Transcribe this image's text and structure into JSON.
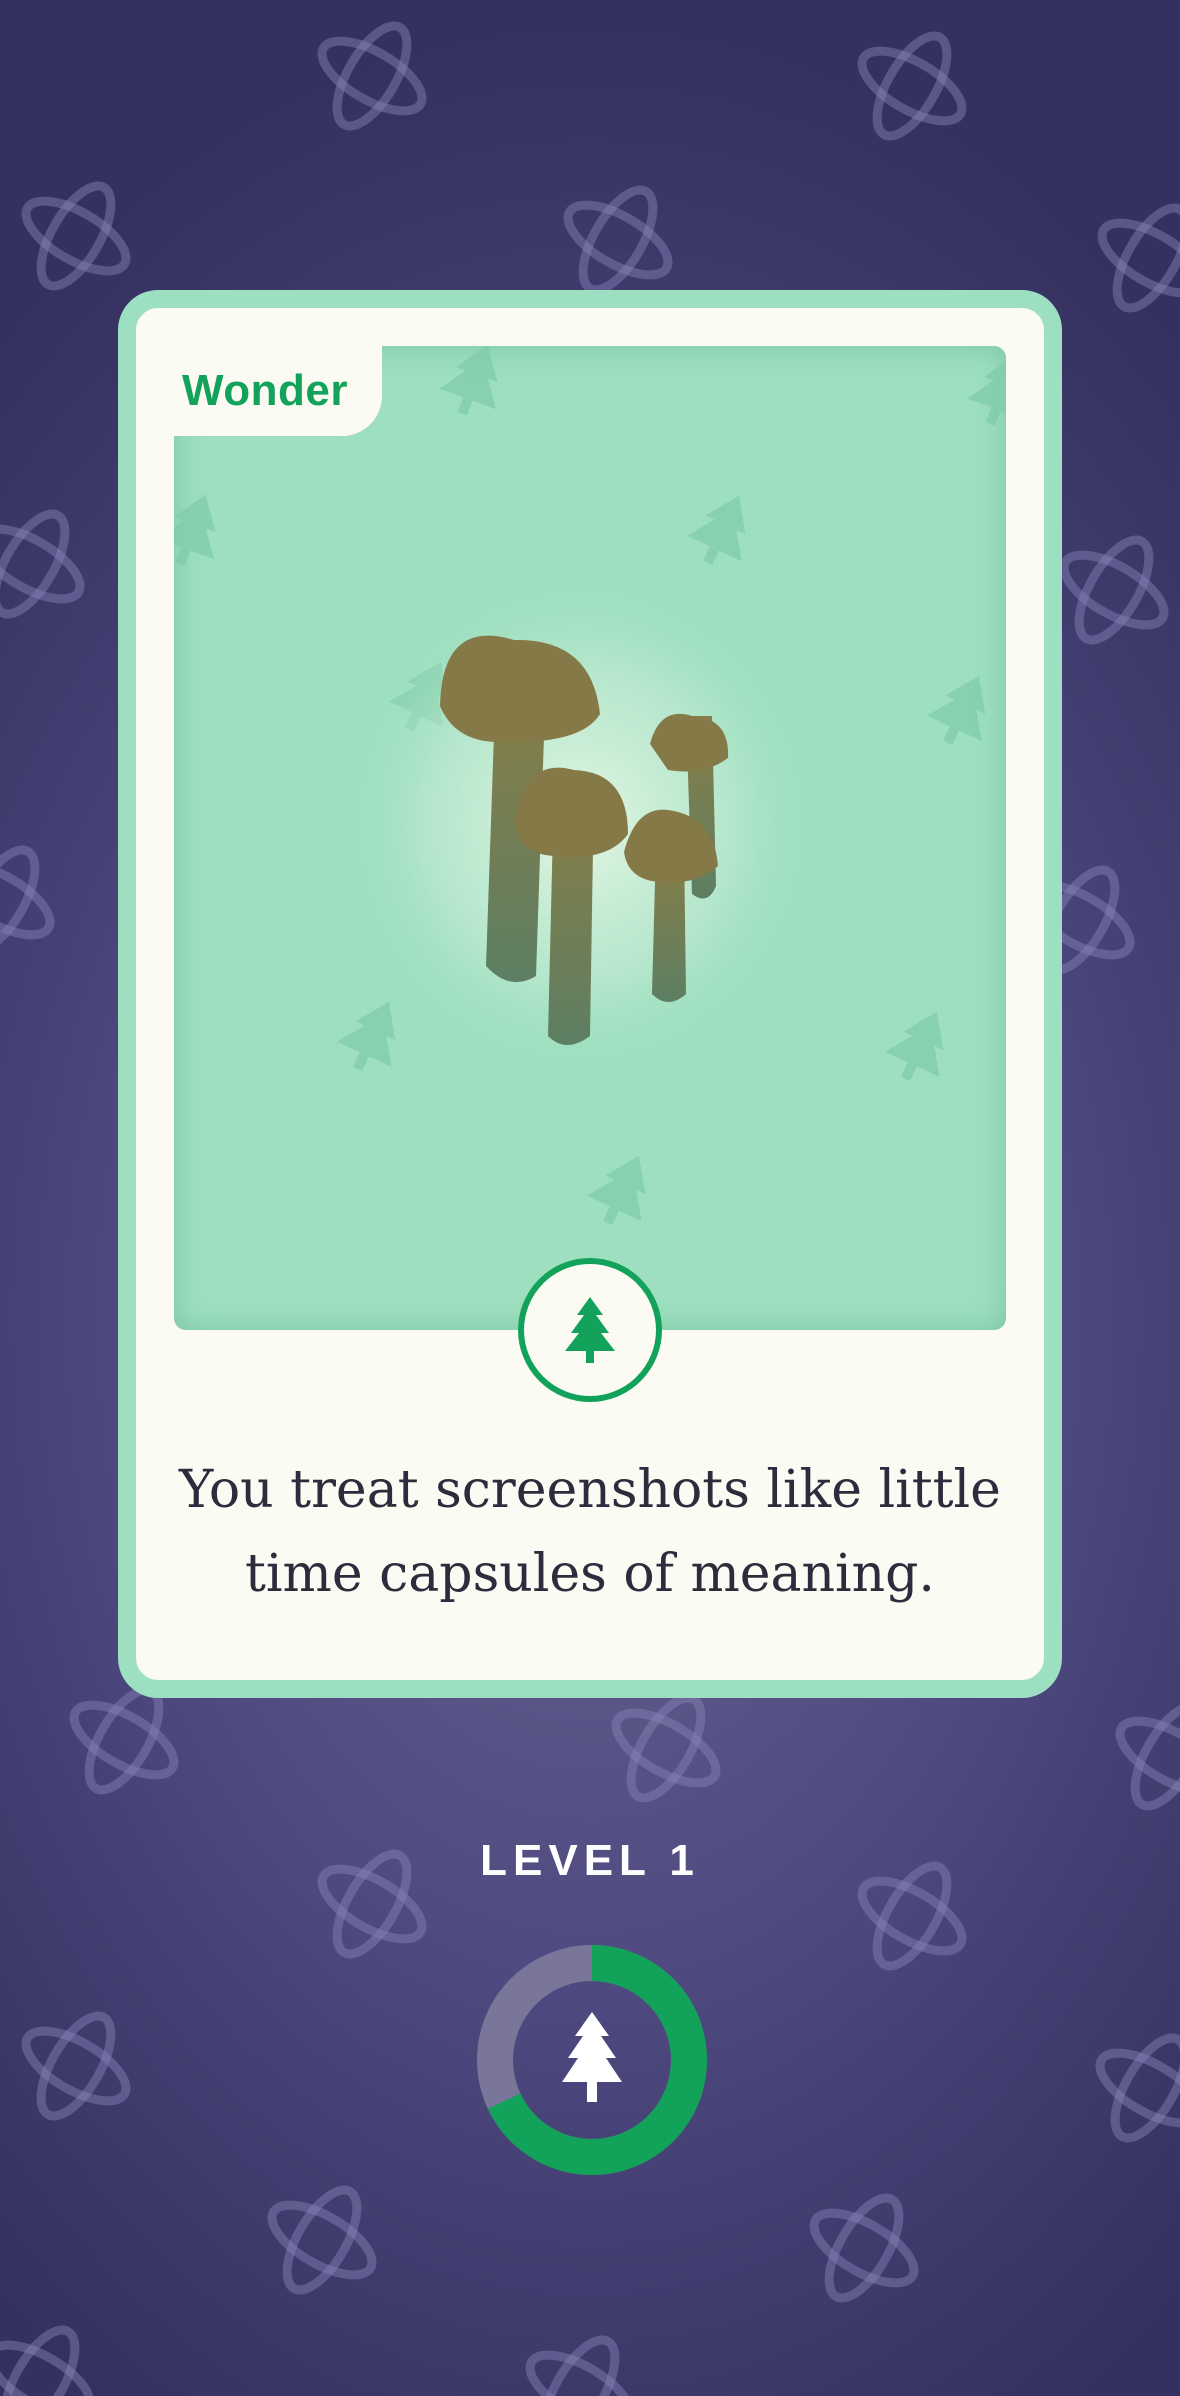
{
  "card": {
    "category": "Wonder",
    "message_line1": "You treat screenshots like little",
    "message_line2": "time capsules of meaning.",
    "art_icon": "mushrooms-illustration",
    "badge_icon": "pine-tree-icon"
  },
  "level": {
    "label": "LEVEL 1",
    "progress_fraction": 0.68,
    "icon": "pine-tree-icon"
  },
  "colors": {
    "background": "#4f4a80",
    "card_border": "#9ddfc1",
    "card_surface": "#fbfaf3",
    "art_background": "#9ddfbf",
    "accent_green": "#12a25a",
    "ring_track": "#7a7699"
  }
}
